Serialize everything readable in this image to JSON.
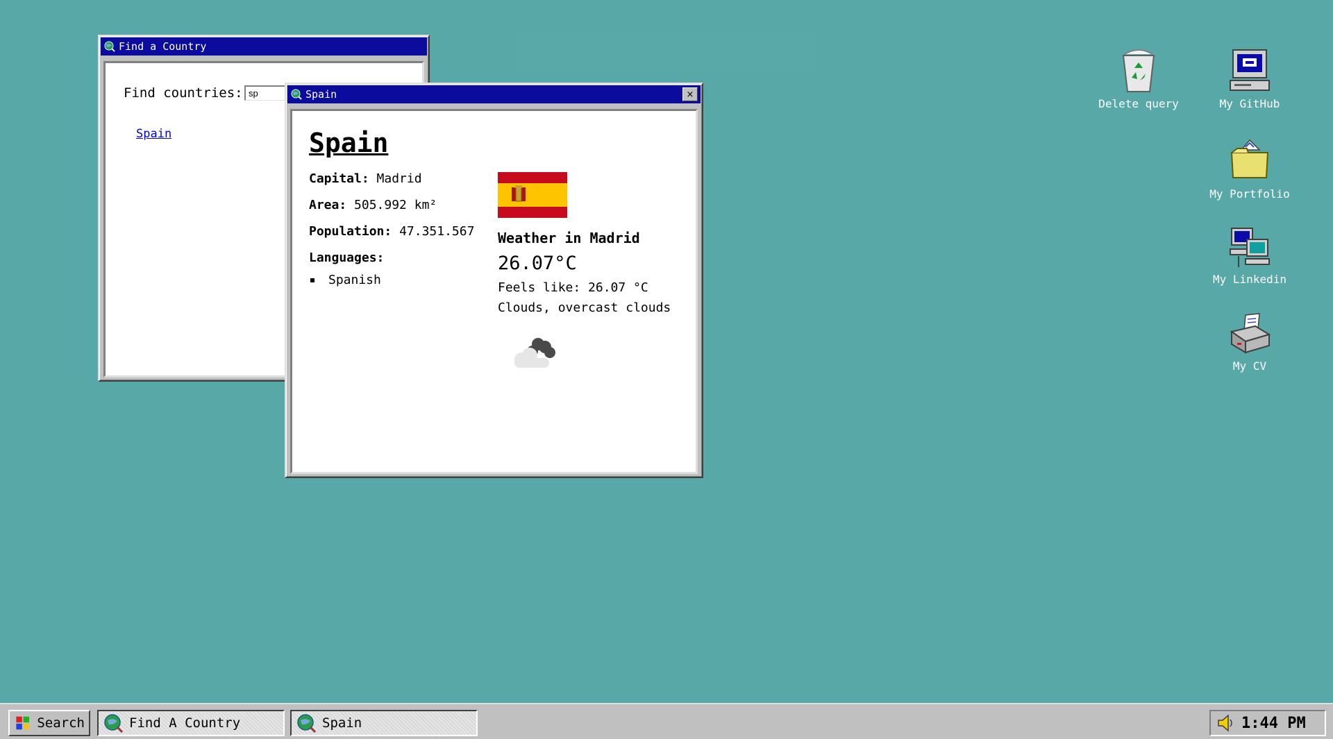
{
  "find_window": {
    "title": "Find a Country",
    "label": "Find countries:",
    "input_value": "sp",
    "results": [
      "Spain"
    ]
  },
  "country_window": {
    "title": "Spain",
    "close_label": "×",
    "name": "Spain",
    "capital_label": "Capital:",
    "capital": "Madrid",
    "area_label": "Area:",
    "area": "505.992 km²",
    "population_label": "Population:",
    "population": "47.351.567",
    "languages_label": "Languages:",
    "languages": [
      "Spanish"
    ],
    "weather_title": "Weather in Madrid",
    "temperature": "26.07°C",
    "feels_like": "Feels like: 26.07 °C",
    "description": "Clouds, overcast clouds",
    "weather_icon": "overcast-clouds-icon"
  },
  "desktop_icons": [
    {
      "label": "Delete query",
      "icon": "recycle-bin-icon"
    },
    {
      "label": "My GitHub",
      "icon": "computer-icon"
    },
    {
      "label": "My Portfolio",
      "icon": "folder-icon"
    },
    {
      "label": "My Linkedin",
      "icon": "network-icon"
    },
    {
      "label": "My CV",
      "icon": "printer-icon"
    }
  ],
  "taskbar": {
    "start_label": "Search",
    "tasks": [
      "Find A Country",
      "Spain"
    ],
    "clock": "1:44 PM"
  },
  "colors": {
    "desktop": "#58a8a8",
    "titlebar": "#0b0c9e",
    "flag_red": "#c60b1e",
    "flag_yellow": "#ffc400"
  }
}
